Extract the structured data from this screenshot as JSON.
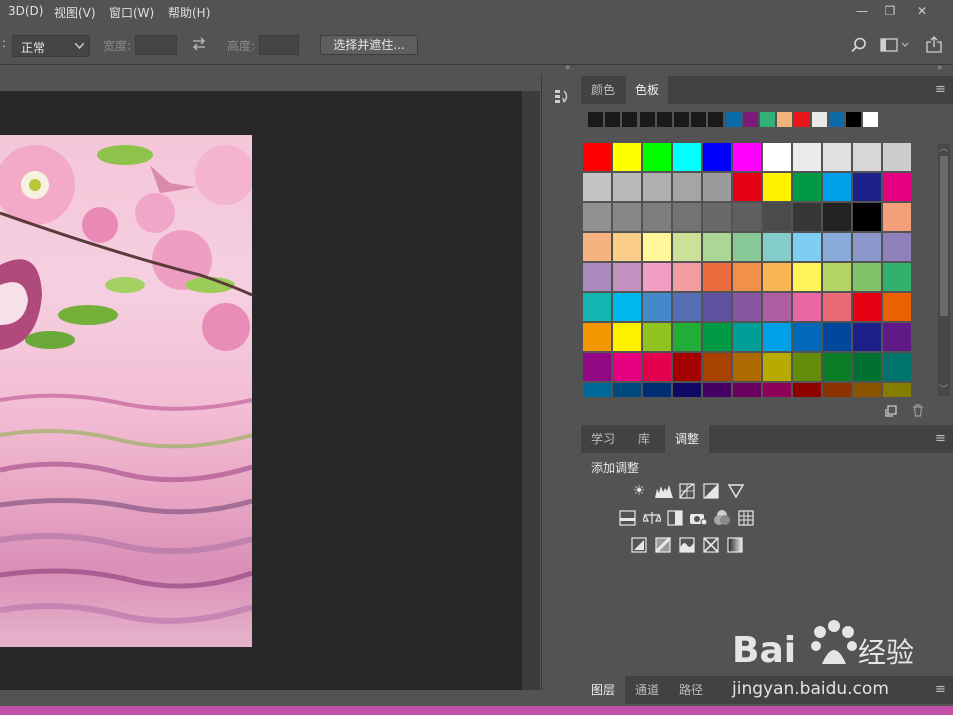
{
  "menubar": {
    "items": [
      "3D(D)",
      "视图(V)",
      "窗口(W)",
      "帮助(H)"
    ],
    "window_controls": [
      "—",
      "❐",
      "✕"
    ]
  },
  "options": {
    "mode_label": ":",
    "mode_value": "正常",
    "width_label": "宽度:",
    "height_label": "高度:",
    "select_mask_button": "选择并遮住..."
  },
  "panels": {
    "color_tabs": [
      "颜色",
      "色板"
    ],
    "adjust_tabs": [
      "学习",
      "库",
      "调整"
    ],
    "adjust_title": "添加调整",
    "layer_tabs": [
      "图层",
      "通道",
      "路径"
    ]
  },
  "swatches": {
    "recent": [
      "#1a1a1a",
      "#1a1a1a",
      "#1a1a1a",
      "#1a1a1a",
      "#1a1a1a",
      "#1a1a1a",
      "#1a1a1a",
      "#1a1a1a",
      "#0b6aa8",
      "#7a1a7a",
      "#33b07a",
      "#f3b27a",
      "#e8151b",
      "#e9e9e9",
      "#0b6aa8",
      "#000000",
      "#ffffff"
    ],
    "grid": [
      [
        "#ff0000",
        "#ffff00",
        "#00ff00",
        "#00ffff",
        "#0000ff",
        "#ff00ff",
        "#ffffff",
        "#ebebeb",
        "#e1e1e1",
        "#d7d7d7",
        "#cdcdcd"
      ],
      [
        "#c3c3c3",
        "#b9b9b9",
        "#afafaf",
        "#a5a5a5",
        "#9b9b9b",
        "#e50012",
        "#fff100",
        "#009944",
        "#00a0e9",
        "#1d2088",
        "#e4007f"
      ],
      [
        "#919191",
        "#878787",
        "#7d7d7d",
        "#737373",
        "#696969",
        "#5f5f5f",
        "#4b4b4b",
        "#373737",
        "#232323",
        "#000000",
        "#f3a07a"
      ],
      [
        "#f6b37f",
        "#facd89",
        "#fff799",
        "#cce198",
        "#acd598",
        "#89c997",
        "#84ccc9",
        "#7ecef4",
        "#88abda",
        "#8c97cb",
        "#8f82bc"
      ],
      [
        "#aa89bd",
        "#c490bf",
        "#f19ec2",
        "#f29c9f",
        "#eb6d3f",
        "#f19149",
        "#f8b551",
        "#fff45c",
        "#b3d465",
        "#80c269",
        "#32b16c"
      ],
      [
        "#13b5b1",
        "#00b7ee",
        "#448aca",
        "#556fb5",
        "#5f52a0",
        "#8957a1",
        "#ae5da1",
        "#ea68a2",
        "#eb6877",
        "#e60012",
        "#eb6100"
      ],
      [
        "#f39800",
        "#fff100",
        "#8fc31f",
        "#22ac38",
        "#009944",
        "#009e96",
        "#00a0e9",
        "#0068b7",
        "#00479d",
        "#1d2088",
        "#601986"
      ],
      [
        "#920783",
        "#e4007f",
        "#e5004f",
        "#a40000",
        "#a84200",
        "#ac6a00",
        "#b7aa00",
        "#638c0b",
        "#097c25",
        "#007130",
        "#00736d"
      ],
      [
        "#00699c",
        "#004a80",
        "#002e73",
        "#100964",
        "#440062",
        "#6a005f",
        "#8f0058",
        "#8d0000",
        "#8b3200",
        "#8b5500",
        "#857d00"
      ]
    ]
  }
}
